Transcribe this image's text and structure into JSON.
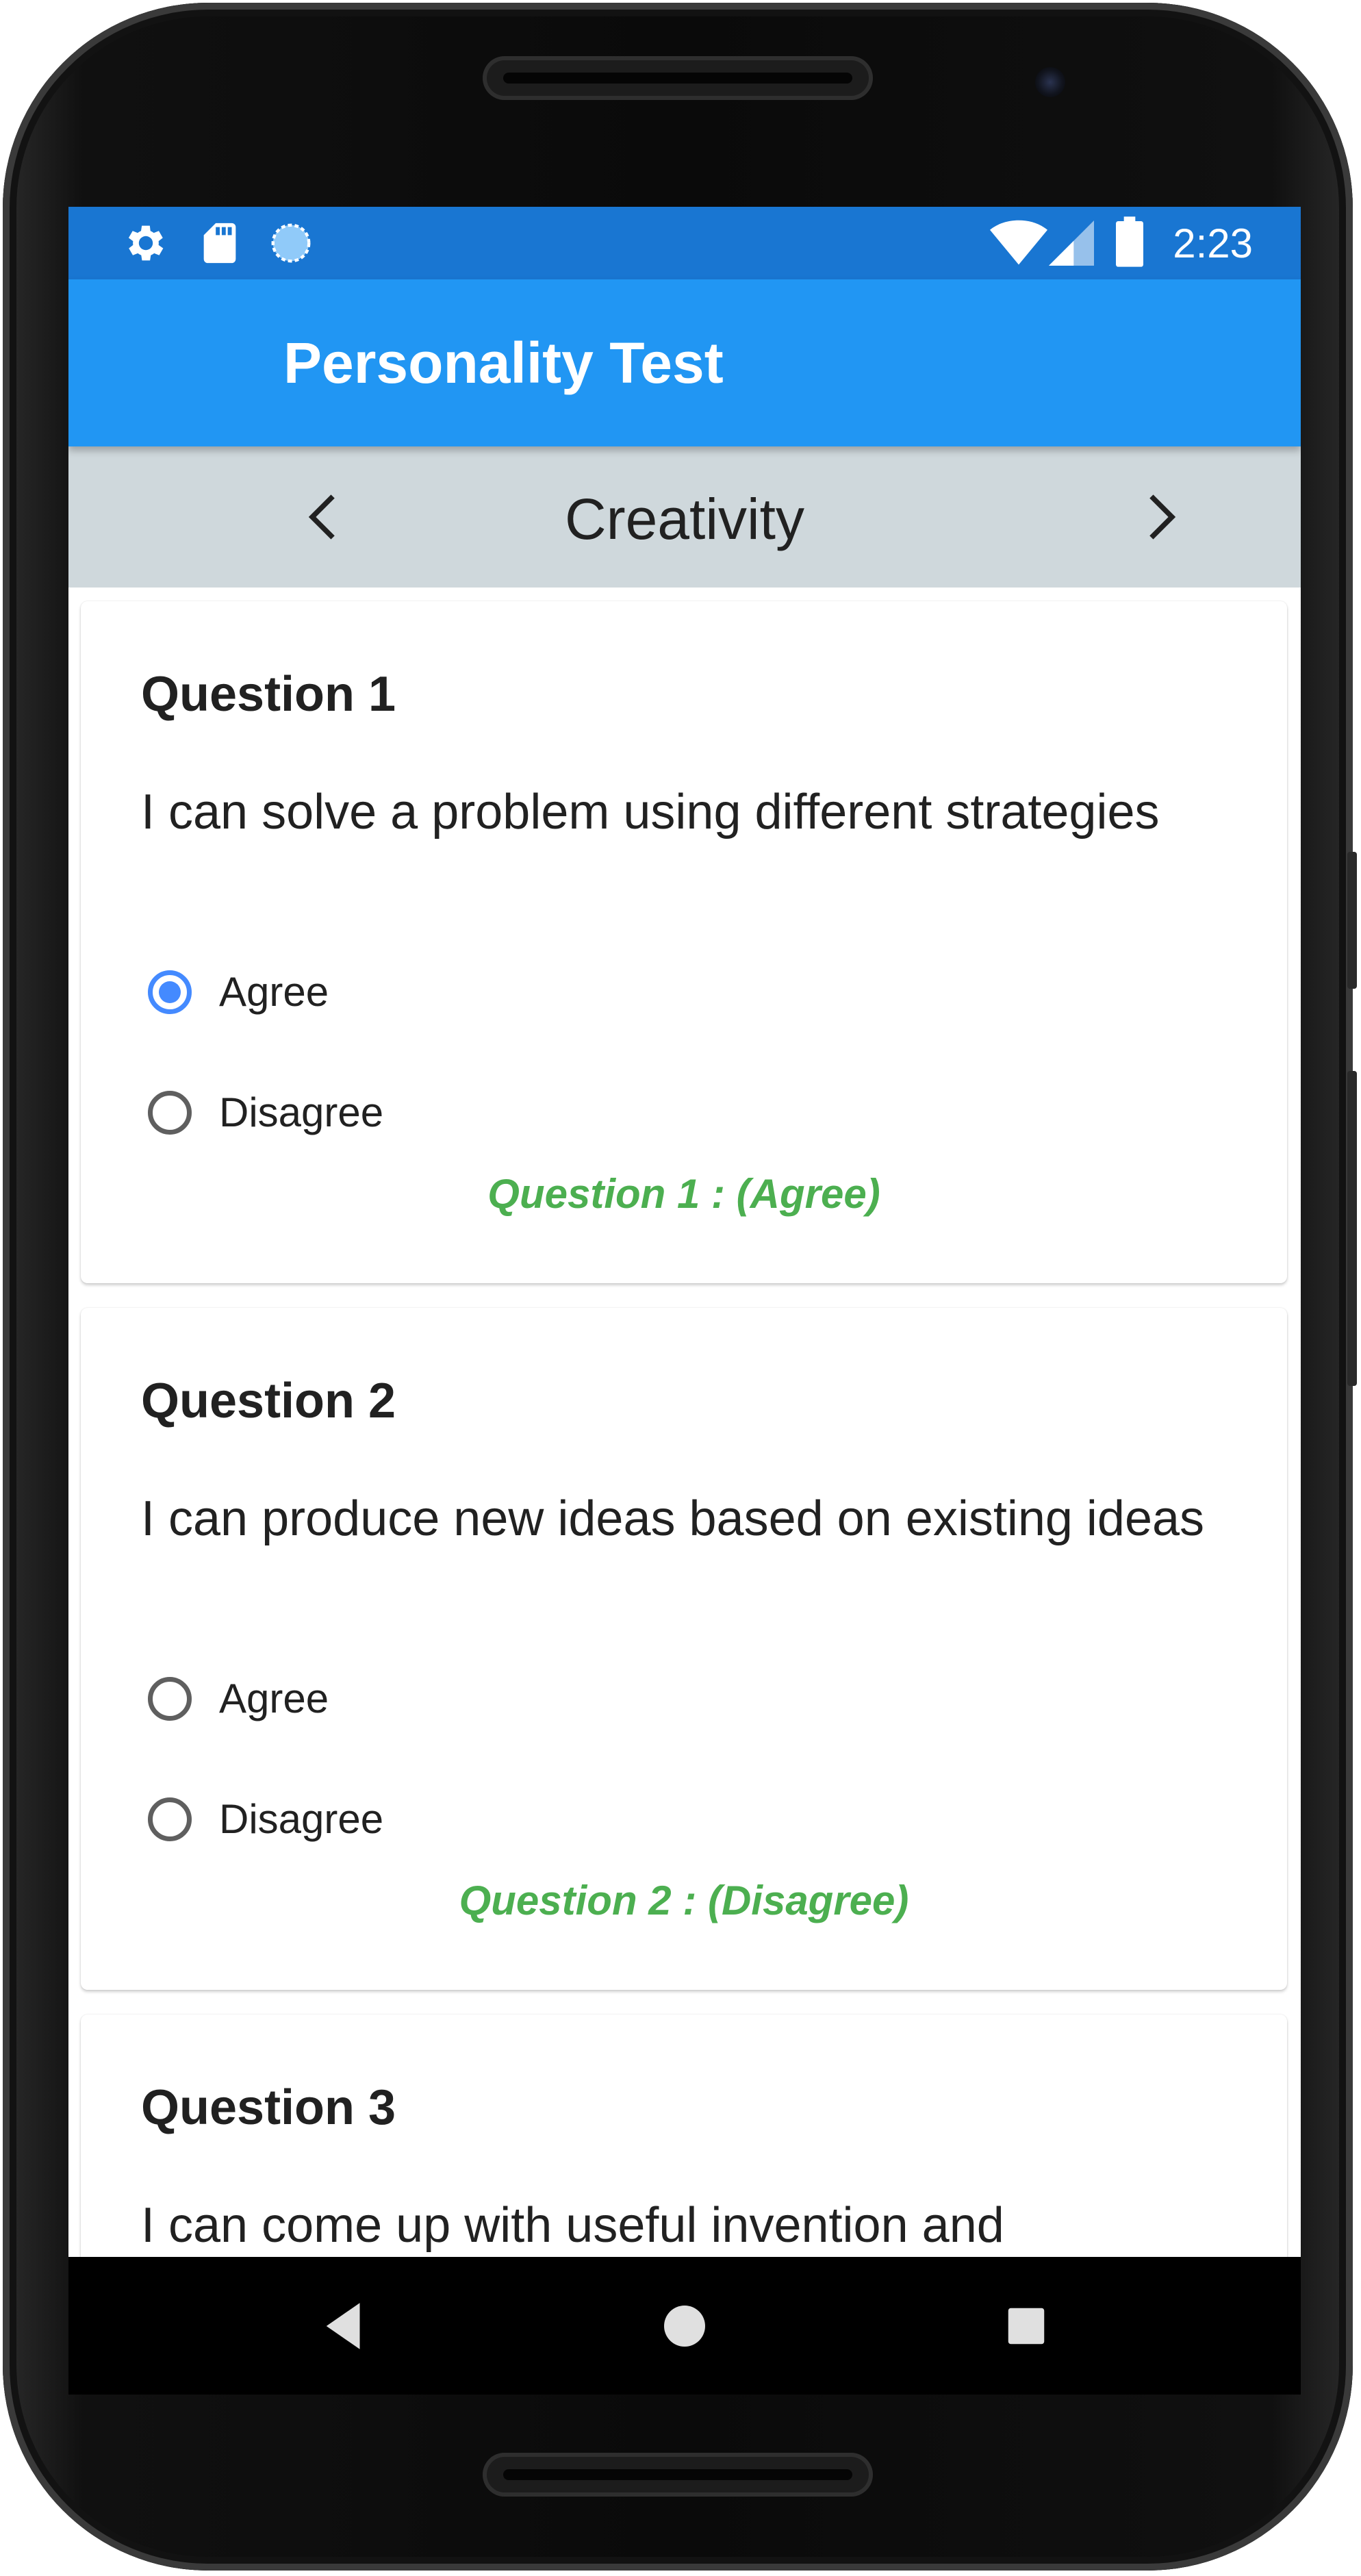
{
  "status_bar": {
    "time": "2:23",
    "left_icons": [
      "settings-icon",
      "sd-card-icon",
      "sync-icon"
    ],
    "right_icons": [
      "wifi-icon",
      "cellular-signal-icon",
      "battery-icon"
    ]
  },
  "app_bar": {
    "title": "Personality Test"
  },
  "category_nav": {
    "title": "Creativity",
    "prev_icon": "chevron-left-icon",
    "next_icon": "chevron-right-icon"
  },
  "questions": [
    {
      "title": "Question 1",
      "text": "I can solve a problem using different strategies",
      "options": [
        {
          "label": "Agree",
          "selected": true
        },
        {
          "label": "Disagree",
          "selected": false
        }
      ],
      "answer_text": "Question 1 : (Agree)"
    },
    {
      "title": "Question 2",
      "text": "I can produce new ideas based on existing ideas",
      "options": [
        {
          "label": "Agree",
          "selected": false
        },
        {
          "label": "Disagree",
          "selected": false
        }
      ],
      "answer_text": "Question 2 : (Disagree)"
    },
    {
      "title": "Question 3",
      "text": "I can come up with useful invention and"
    }
  ],
  "system_nav": {
    "icons": [
      "back-icon",
      "home-icon",
      "recents-icon"
    ]
  },
  "colors": {
    "status_bar": "#1976D2",
    "app_bar": "#2196F3",
    "nav_bar": "#CFD8DC",
    "radio_selected": "#448AFF",
    "answer_text": "#4CAF50"
  }
}
